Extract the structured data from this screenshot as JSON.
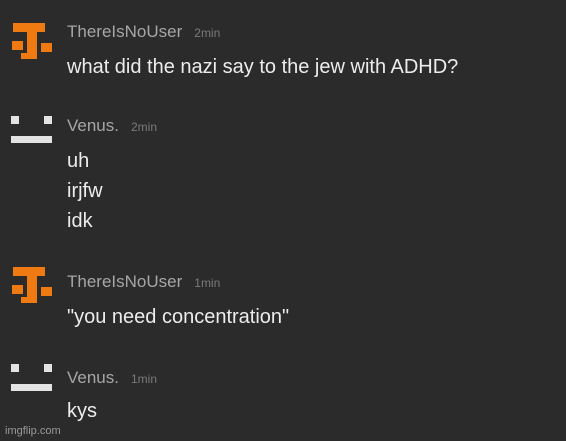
{
  "messages": [
    {
      "username": "ThereIsNoUser",
      "time": "2min",
      "avatar_icon": "orange-glyph-avatar-icon",
      "lines": [
        "what did the nazi say to the jew with ADHD?"
      ]
    },
    {
      "username": "Venus.",
      "time": "2min",
      "avatar_icon": "neutral-face-avatar-icon",
      "lines": [
        "uh",
        "irjfw",
        "idk"
      ]
    },
    {
      "username": "ThereIsNoUser",
      "time": "1min",
      "avatar_icon": "orange-glyph-avatar-icon",
      "lines": [
        "\"you need concentration\""
      ]
    },
    {
      "username": "Venus.",
      "time": "1min",
      "avatar_icon": "neutral-face-avatar-icon",
      "lines": [
        "kys"
      ]
    }
  ],
  "watermark": "imgflip.com",
  "colors": {
    "background": "#2b2b2b",
    "orange_avatar": "#f07a12",
    "gray_avatar": "#e3e3e3"
  }
}
